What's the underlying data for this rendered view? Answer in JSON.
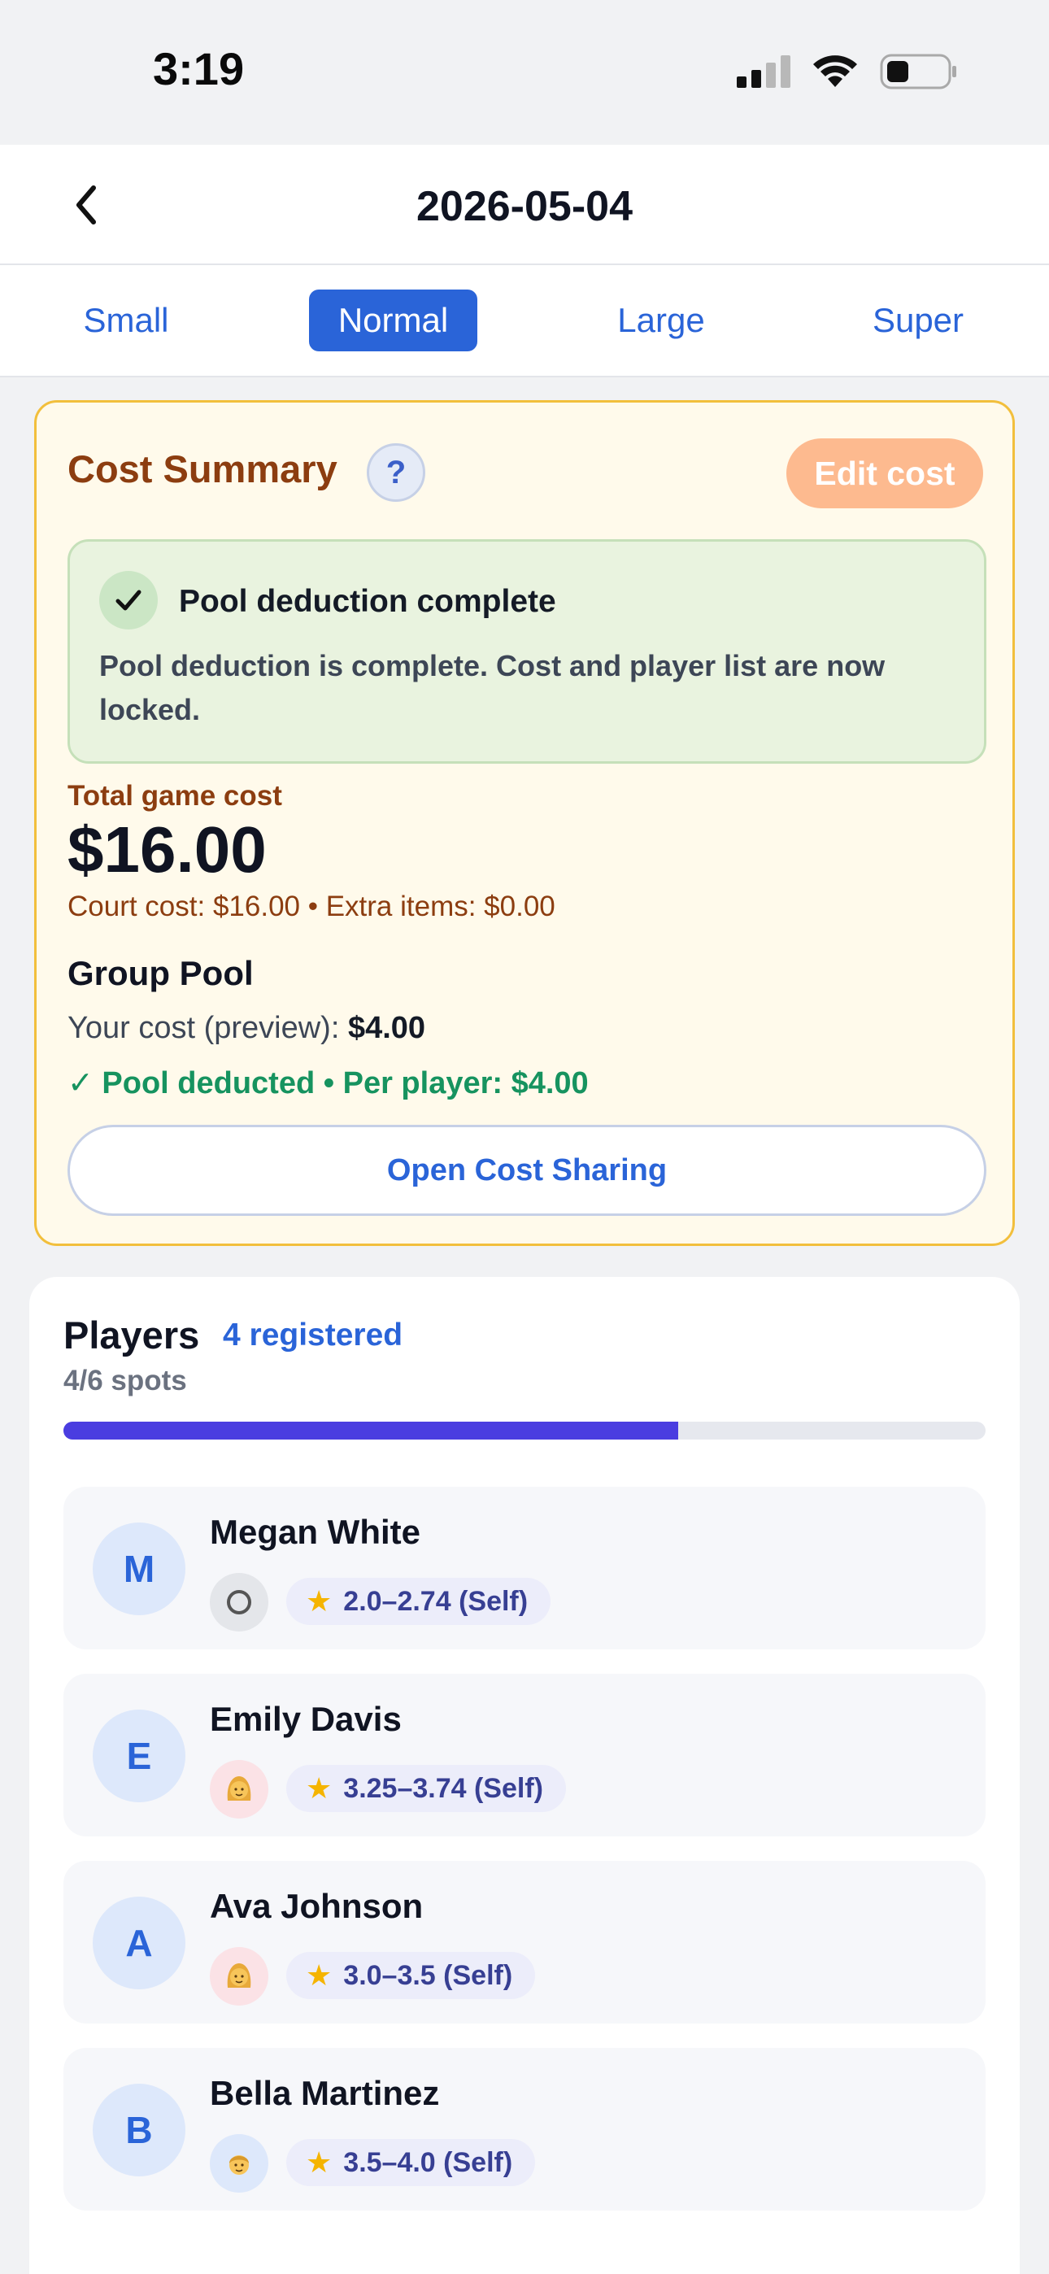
{
  "status_bar": {
    "time": "3:19"
  },
  "header": {
    "title": "2026-05-04"
  },
  "tabs": [
    {
      "label": "Small",
      "active": false
    },
    {
      "label": "Normal",
      "active": true
    },
    {
      "label": "Large",
      "active": false
    },
    {
      "label": "Super",
      "active": false
    }
  ],
  "cost_summary": {
    "title": "Cost Summary",
    "help_label": "?",
    "edit_label": "Edit cost",
    "notice": {
      "title": "Pool deduction complete",
      "body": "Pool deduction is complete. Cost and player list are now locked."
    },
    "total_label": "Total game cost",
    "total_value": "$16.00",
    "breakdown": "Court cost: $16.00 • Extra items: $0.00",
    "pool": {
      "title": "Group Pool",
      "preview_label": "Your cost (preview):",
      "preview_value": "$4.00",
      "status": "✓ Pool deducted • Per player: $4.00"
    },
    "share_button": "Open Cost Sharing"
  },
  "players": {
    "title": "Players",
    "registered": "4 registered",
    "spots": "4/6 spots",
    "fill_fraction": 0.667,
    "list": [
      {
        "initial": "M",
        "name": "Megan White",
        "gender": "unspecified",
        "rating": "2.0–2.74 (Self)"
      },
      {
        "initial": "E",
        "name": "Emily Davis",
        "gender": "female",
        "rating": "3.25–3.74 (Self)"
      },
      {
        "initial": "A",
        "name": "Ava Johnson",
        "gender": "female",
        "rating": "3.0–3.5 (Self)"
      },
      {
        "initial": "B",
        "name": "Bella Martinez",
        "gender": "male",
        "rating": "3.5–4.0 (Self)"
      }
    ]
  },
  "colors": {
    "accent": "#2a64d8",
    "progress": "#4a3de0",
    "cost_card_bg": "#fffaeb",
    "cost_card_border": "#f2bf3c",
    "pool_ok": "#16935f",
    "edit_button": "#fdba8f"
  }
}
